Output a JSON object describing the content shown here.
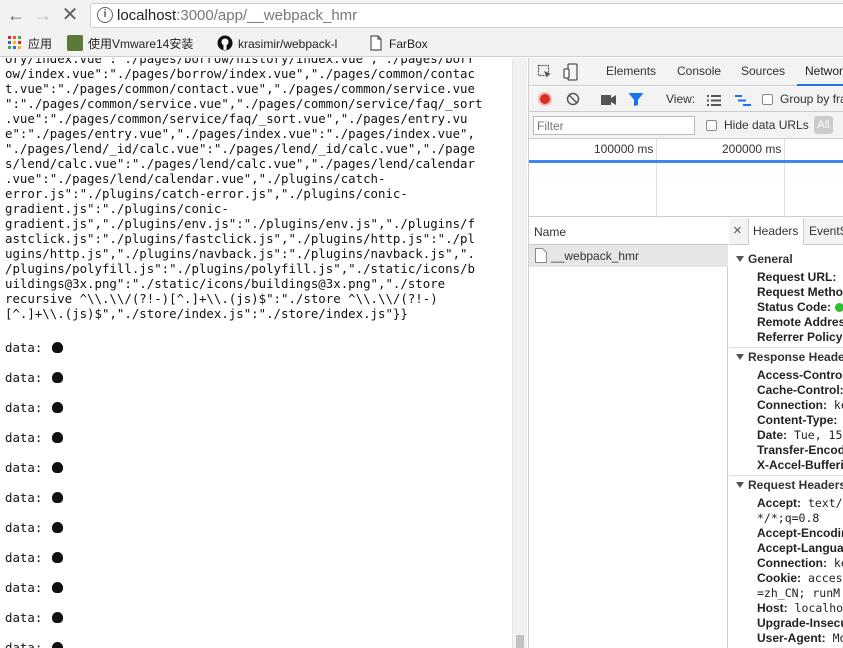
{
  "browser": {
    "url_host": "localhost",
    "url_rest": ":3000/app/__webpack_hmr",
    "info_icon": "info-icon"
  },
  "bookmarks": [
    {
      "label": "应用",
      "icon": "apps-grid-icon"
    },
    {
      "label": "使用Vmware14安装",
      "icon": "bookmark-image-icon"
    },
    {
      "label": "krasimir/webpack-l",
      "icon": "github-icon"
    },
    {
      "label": "FarBox",
      "icon": "page-icon"
    }
  ],
  "page": {
    "code_lines": [
      "ory/index.vue\":\"./pages/borrow/history/index.vue\",\"./pages/borr",
      "ow/index.vue\":\"./pages/borrow/index.vue\",\"./pages/common/contac",
      "t.vue\":\"./pages/common/contact.vue\",\"./pages/common/service.vue",
      "\":\"./pages/common/service.vue\",\"./pages/common/service/faq/_sort",
      ".vue\":\"./pages/common/service/faq/_sort.vue\",\"./pages/entry.vu",
      "e\":\"./pages/entry.vue\",\"./pages/index.vue\":\"./pages/index.vue\",",
      "\"./pages/lend/_id/calc.vue\":\"./pages/lend/_id/calc.vue\",\"./page",
      "s/lend/calc.vue\":\"./pages/lend/calc.vue\",\"./pages/lend/calendar",
      ".vue\":\"./pages/lend/calendar.vue\",\"./plugins/catch-",
      "error.js\":\"./plugins/catch-error.js\",\"./plugins/conic-",
      "gradient.js\":\"./plugins/conic-",
      "gradient.js\",\"./plugins/env.js\":\"./plugins/env.js\",\"./plugins/f",
      "astclick.js\":\"./plugins/fastclick.js\",\"./plugins/http.js\":\"./pl",
      "ugins/http.js\",\"./plugins/navback.js\":\"./plugins/navback.js\",\".",
      "/plugins/polyfill.js\":\"./plugins/polyfill.js\",\"./static/icons/b",
      "uildings@3x.png\":\"./static/icons/buildings@3x.png\",\"./store",
      "recursive ^\\\\.\\\\/(?!-)[^.]+\\\\.(js)$\":\"./store ^\\\\.\\\\/(?!-)",
      "[^.]+\\\\.(js)$\",\"./store/index.js\":\"./store/index.js\"}}"
    ],
    "data_prefix": "data:",
    "data_rows": 11
  },
  "devtools": {
    "tabs": [
      "Elements",
      "Console",
      "Sources",
      "Network"
    ],
    "active_tab": "Network",
    "toolbar": {
      "view_label": "View:",
      "group_by_frame": "Group by frame"
    },
    "filter": {
      "placeholder": "Filter",
      "hide_data_urls": "Hide data URLs",
      "all_label": "All"
    },
    "timeline": {
      "ticks": [
        "100000 ms",
        "200000 ms"
      ]
    },
    "request_list": {
      "name_header": "Name",
      "rows": [
        "__webpack_hmr"
      ]
    },
    "details": {
      "close": "×",
      "tabs": [
        "Headers",
        "EventStream"
      ],
      "general": {
        "title": "General",
        "rows": [
          "Request URL:",
          "Request Method:",
          "Status Code:",
          "Remote Address:",
          "Referrer Policy:"
        ]
      },
      "response_headers": {
        "title": "Response Headers",
        "rows": [
          {
            "k": "Access-Control-",
            "v": ""
          },
          {
            "k": "Cache-Control:",
            "v": ""
          },
          {
            "k": "Connection:",
            "v": "ke"
          },
          {
            "k": "Content-Type:",
            "v": ""
          },
          {
            "k": "Date:",
            "v": "Tue, 15"
          },
          {
            "k": "Transfer-Encoding",
            "v": ""
          },
          {
            "k": "X-Accel-Buffering",
            "v": ""
          }
        ]
      },
      "request_headers": {
        "title": "Request Headers",
        "rows": [
          {
            "k": "Accept:",
            "v": "text/"
          },
          {
            "k": "",
            "v": "*/*;q=0.8"
          },
          {
            "k": "Accept-Encoding",
            "v": ""
          },
          {
            "k": "Accept-Language",
            "v": ""
          },
          {
            "k": "Connection:",
            "v": "ke"
          },
          {
            "k": "Cookie:",
            "v": "acces"
          },
          {
            "k": "",
            "v": "=zh_CN; runM"
          },
          {
            "k": "Host:",
            "v": "localho"
          },
          {
            "k": "Upgrade-Insecure",
            "v": ""
          },
          {
            "k": "User-Agent:",
            "v": "Mo"
          }
        ]
      }
    },
    "status_color": "#2dc02d",
    "record_color": "#d93025",
    "accent": "#1a73e8"
  }
}
